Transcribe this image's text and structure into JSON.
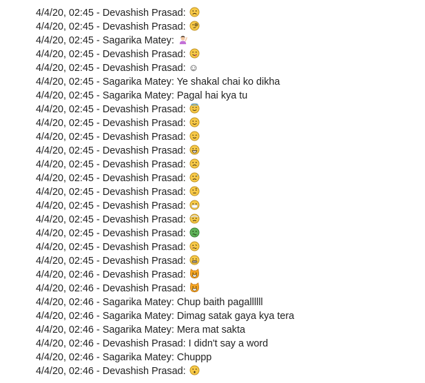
{
  "chat": {
    "lines": [
      {
        "timestamp": "4/4/20, 02:45",
        "sender": "Devashish Prasad",
        "text": "",
        "emoji": "frowning-face"
      },
      {
        "timestamp": "4/4/20, 02:45",
        "sender": "Devashish Prasad",
        "text": "",
        "emoji": "face-with-monocle"
      },
      {
        "timestamp": "4/4/20, 02:45",
        "sender": "Sagarika Matey",
        "text": "",
        "emoji": "woman-raising-hand"
      },
      {
        "timestamp": "4/4/20, 02:45",
        "sender": "Devashish Prasad",
        "text": "",
        "emoji": "face-savoring-food"
      },
      {
        "timestamp": "4/4/20, 02:45",
        "sender": "Devashish Prasad",
        "text": "☺",
        "emoji": ""
      },
      {
        "timestamp": "4/4/20, 02:45",
        "sender": "Sagarika Matey",
        "text": "Ye shakal chai ko dikha",
        "emoji": ""
      },
      {
        "timestamp": "4/4/20, 02:45",
        "sender": "Sagarika Matey",
        "text": "Pagal hai kya tu",
        "emoji": ""
      },
      {
        "timestamp": "4/4/20, 02:45",
        "sender": "Devashish Prasad",
        "text": "",
        "emoji": "smiling-face-with-halo"
      },
      {
        "timestamp": "4/4/20, 02:45",
        "sender": "Devashish Prasad",
        "text": "",
        "emoji": "winking-face"
      },
      {
        "timestamp": "4/4/20, 02:45",
        "sender": "Devashish Prasad",
        "text": "",
        "emoji": "relieved-face"
      },
      {
        "timestamp": "4/4/20, 02:45",
        "sender": "Devashish Prasad",
        "text": "",
        "emoji": "grinning-face"
      },
      {
        "timestamp": "4/4/20, 02:45",
        "sender": "Devashish Prasad",
        "text": "",
        "emoji": "frowning-face"
      },
      {
        "timestamp": "4/4/20, 02:45",
        "sender": "Devashish Prasad",
        "text": "",
        "emoji": "downcast-face-with-sweat"
      },
      {
        "timestamp": "4/4/20, 02:45",
        "sender": "Devashish Prasad",
        "text": "",
        "emoji": "face-with-raised-eyebrow"
      },
      {
        "timestamp": "4/4/20, 02:45",
        "sender": "Devashish Prasad",
        "text": "",
        "emoji": "face-with-medical-mask"
      },
      {
        "timestamp": "4/4/20, 02:45",
        "sender": "Devashish Prasad",
        "text": "",
        "emoji": "face-with-head-bandage"
      },
      {
        "timestamp": "4/4/20, 02:45",
        "sender": "Devashish Prasad",
        "text": "",
        "emoji": "nauseated-face"
      },
      {
        "timestamp": "4/4/20, 02:45",
        "sender": "Devashish Prasad",
        "text": "",
        "emoji": "woozy-face"
      },
      {
        "timestamp": "4/4/20, 02:45",
        "sender": "Devashish Prasad",
        "text": "",
        "emoji": "grimacing-face"
      },
      {
        "timestamp": "4/4/20, 02:46",
        "sender": "Devashish Prasad",
        "text": "",
        "emoji": "grinning-cat-face"
      },
      {
        "timestamp": "4/4/20, 02:46",
        "sender": "Devashish Prasad",
        "text": "",
        "emoji": "grinning-cat-face"
      },
      {
        "timestamp": "4/4/20, 02:46",
        "sender": "Sagarika Matey",
        "text": "Chup baith pagallllll",
        "emoji": ""
      },
      {
        "timestamp": "4/4/20, 02:46",
        "sender": "Sagarika Matey",
        "text": "Dimag satak gaya kya tera",
        "emoji": ""
      },
      {
        "timestamp": "4/4/20, 02:46",
        "sender": "Sagarika Matey",
        "text": "Mera mat sakta",
        "emoji": ""
      },
      {
        "timestamp": "4/4/20, 02:46",
        "sender": "Devashish Prasad",
        "text": "I didn't say a word",
        "emoji": ""
      },
      {
        "timestamp": "4/4/20, 02:46",
        "sender": "Sagarika Matey",
        "text": "Chuppp",
        "emoji": ""
      },
      {
        "timestamp": "4/4/20, 02:46",
        "sender": "Devashish Prasad",
        "text": "",
        "emoji": "hushed-face"
      }
    ]
  },
  "colors": {
    "text": "#222222",
    "emoji_yellow": "#f7c948",
    "emoji_outline": "#b98a16",
    "emoji_green": "#5fb35a",
    "emoji_cat": "#f5a623"
  }
}
